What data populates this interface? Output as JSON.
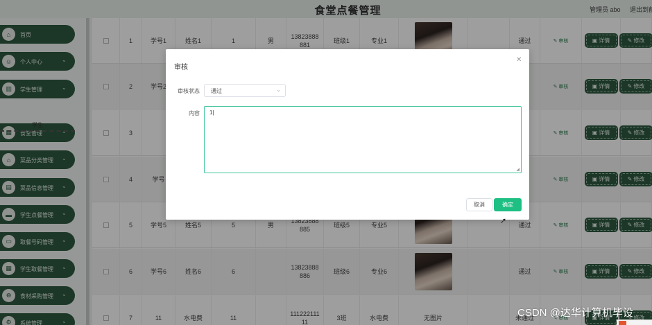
{
  "header": {
    "title": "食堂点餐管理",
    "admin": "管理员 abo",
    "logout": "退出到前"
  },
  "sidebar": {
    "items": [
      {
        "label": "首页",
        "icon": "home-icon",
        "glyph": "⌂",
        "has_arrow": false
      },
      {
        "label": "个人中心",
        "icon": "user-icon",
        "glyph": "☺",
        "has_arrow": true
      },
      {
        "label": "学生管理",
        "icon": "chart-icon",
        "glyph": "▥",
        "has_arrow": true
      },
      {
        "label": "食堂管理",
        "icon": "grid-icon",
        "glyph": "▦",
        "has_arrow": true
      },
      {
        "label": "菜品分类管理",
        "icon": "home-icon",
        "glyph": "⌂",
        "has_arrow": true
      },
      {
        "label": "菜品信息管理",
        "icon": "building-icon",
        "glyph": "▤",
        "has_arrow": true
      },
      {
        "label": "学生点餐管理",
        "icon": "bag-icon",
        "glyph": "▬",
        "has_arrow": true
      },
      {
        "label": "取餐号码管理",
        "icon": "ticket-icon",
        "glyph": "▭",
        "has_arrow": true
      },
      {
        "label": "学生取餐管理",
        "icon": "grid-icon",
        "glyph": "▦",
        "has_arrow": true
      },
      {
        "label": "食材采购管理",
        "icon": "cart-icon",
        "glyph": "⊖",
        "has_arrow": true
      },
      {
        "label": "系统管理",
        "icon": "gear-icon",
        "glyph": "⚙",
        "has_arrow": true
      }
    ],
    "sub_item": "学生"
  },
  "table": {
    "rows": [
      {
        "index": "1",
        "student_no": "学号1",
        "name": "姓名1",
        "field": "1",
        "gender": "男",
        "phone": "13823888881",
        "class": "班级1",
        "major": "专业1",
        "photo": "",
        "status": "通过"
      },
      {
        "index": "2",
        "student_no": "学号2",
        "name": "",
        "field": "",
        "gender": "",
        "phone": "",
        "class": "",
        "major": "",
        "photo": "",
        "status": ""
      },
      {
        "index": "3",
        "student_no": "",
        "name": "",
        "field": "",
        "gender": "",
        "phone": "",
        "class": "",
        "major": "",
        "photo": "",
        "status": ""
      },
      {
        "index": "4",
        "student_no": "学号",
        "name": "",
        "field": "",
        "gender": "",
        "phone": "",
        "class": "",
        "major": "",
        "photo": "",
        "status": ""
      },
      {
        "index": "5",
        "student_no": "学号5",
        "name": "姓名5",
        "field": "5",
        "gender": "男",
        "phone": "13823888885",
        "class": "班级5",
        "major": "专业5",
        "photo": "",
        "status": "通过"
      },
      {
        "index": "6",
        "student_no": "学号6",
        "name": "姓名6",
        "field": "6",
        "gender": "",
        "phone": "13823888886",
        "class": "班级6",
        "major": "专业6",
        "photo": "",
        "status": "通过"
      },
      {
        "index": "7",
        "student_no": "11",
        "name": "水电费",
        "field": "11",
        "gender": "",
        "phone": "11122211111",
        "class": "3班",
        "major": "水电费",
        "photo": "无图片",
        "status": "未通过"
      }
    ],
    "audit_label": "审核",
    "detail_label": "详情",
    "edit_label": "修改"
  },
  "dialog": {
    "title": "审核",
    "status_label": "审核状态",
    "status_value": "通过",
    "content_label": "内容",
    "content_value": "1|",
    "cancel_label": "取消",
    "confirm_label": "确定"
  },
  "watermark": "CSDN @达华计算机毕设",
  "colors": {
    "sidebar_green": "#2e5a40",
    "confirm_green": "#1dbf83",
    "textarea_border": "#3fc49c"
  }
}
